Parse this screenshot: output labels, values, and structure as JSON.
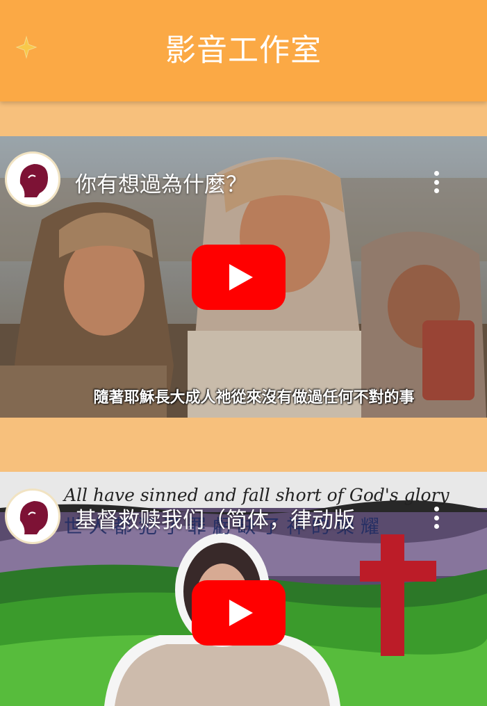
{
  "header": {
    "title": "影音工作室",
    "back_icon": "sparkle-back-icon"
  },
  "videos": [
    {
      "title": "你有想過為什麼？",
      "subtitle": "隨著耶穌長大成人祂從來沒有做過任何不對的事",
      "channel_icon": "channel-avatar-icon",
      "menu_icon": "more-vertical-icon",
      "play_icon": "youtube-play-icon"
    },
    {
      "title": "基督救赎我们（简体，律动版",
      "overlay_text_en": "All have sinned and fall short of God's glory",
      "overlay_text_zh": "世 人 都 犯 了 罪 虧 缺 了 神 的 榮 耀",
      "channel_icon": "channel-avatar-icon",
      "menu_icon": "more-vertical-icon",
      "play_icon": "youtube-play-icon"
    }
  ],
  "colors": {
    "header_bg": "#fba945",
    "page_bg": "#f7c07c",
    "play_red": "#ff0000"
  }
}
